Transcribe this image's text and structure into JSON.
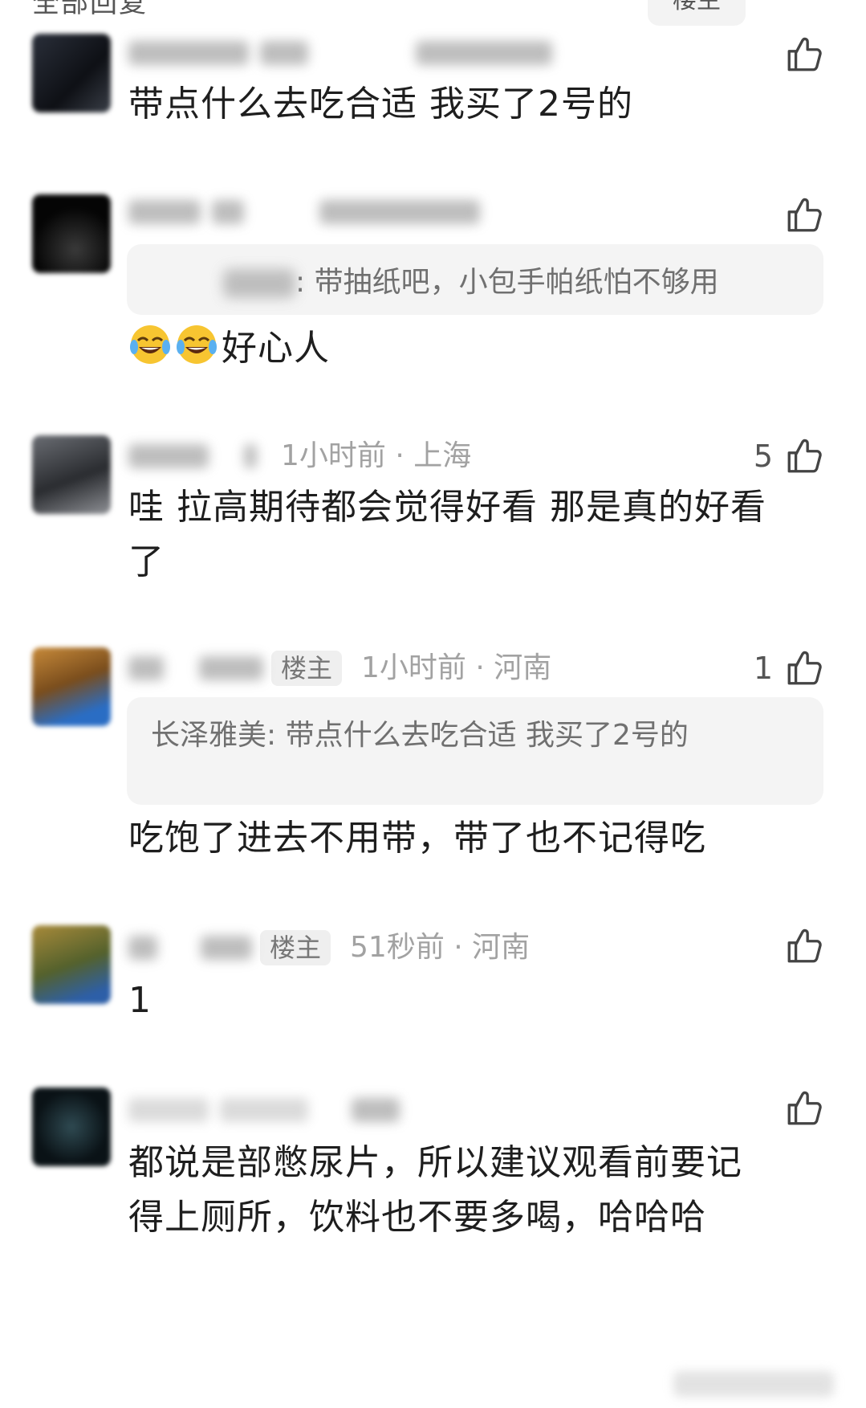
{
  "top": {
    "left_text": "全部回复",
    "right_label": "楼主"
  },
  "comments": [
    {
      "meta": "",
      "likes": "",
      "owner_tag": "",
      "body": "带点什么去吃合适 我买了2号的",
      "quote": null,
      "avatar_color": "#1a1d24"
    },
    {
      "meta": "",
      "likes": "",
      "owner_tag": "",
      "quote": {
        "author": "",
        "text": ": 带抽纸吧，小包手帕纸怕不够用"
      },
      "body": "好心人",
      "emoji_count": 2,
      "avatar_color": "#0b0b0b"
    },
    {
      "meta": "1小时前 · 上海",
      "likes": "5",
      "owner_tag": "",
      "body": "哇 拉高期待都会觉得好看 那是真的好看了",
      "quote": null,
      "avatar_color": "#3d3f45"
    },
    {
      "meta": "1小时前 · 河南",
      "likes": "1",
      "owner_tag": "楼主",
      "quote": {
        "author": "长泽雅美",
        "text": ": 带点什么去吃合适 我买了2号的"
      },
      "body": "吃饱了进去不用带，带了也不记得吃",
      "avatar_color": "#6b5a2a"
    },
    {
      "meta": "51秒前 · 河南",
      "likes": "",
      "owner_tag": "楼主",
      "body": "1",
      "quote": null,
      "avatar_color": "#6e6a3a"
    },
    {
      "meta": "",
      "likes": "",
      "owner_tag": "",
      "body": "都说是部憋尿片，所以建议观看前要记得上厕所，饮料也不要多喝，哈哈哈",
      "quote": null,
      "avatar_color": "#12232a"
    }
  ],
  "icons": {
    "like": "thumbs-up-icon",
    "emoji": "tears-of-joy-emoji"
  }
}
